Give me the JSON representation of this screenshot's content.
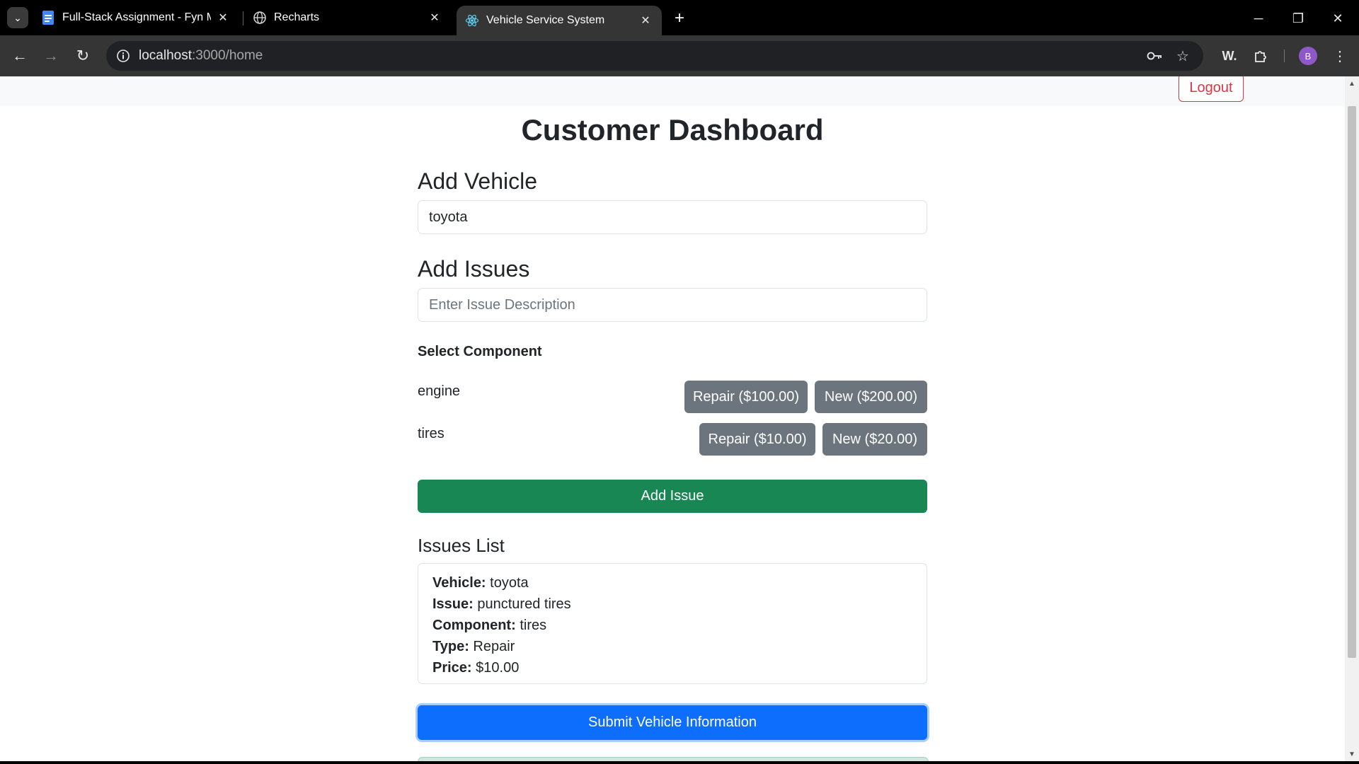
{
  "browser": {
    "tabs": [
      {
        "title": "Full-Stack Assignment - Fyn Mo",
        "favicon": "docs-icon"
      },
      {
        "title": "Recharts",
        "favicon": "globe-icon"
      },
      {
        "title": "Vehicle Service System",
        "favicon": "react-icon",
        "active": true
      }
    ],
    "url_host": "localhost",
    "url_path": ":3000/home",
    "profile_initial": "B",
    "extension_label": "W."
  },
  "nav": {
    "logout_label": "Logout"
  },
  "page": {
    "title": "Customer Dashboard",
    "add_vehicle": {
      "heading": "Add Vehicle",
      "value": "toyota"
    },
    "add_issues": {
      "heading": "Add Issues",
      "placeholder": "Enter Issue Description",
      "select_label": "Select Component",
      "components": [
        {
          "name": "engine",
          "repair_label": "Repair ($100.00)",
          "new_label": "New ($200.00)"
        },
        {
          "name": "tires",
          "repair_label": "Repair ($10.00)",
          "new_label": "New ($20.00)"
        }
      ],
      "add_issue_label": "Add Issue"
    },
    "issues_list": {
      "heading": "Issues List",
      "items": [
        {
          "vehicle_key": "Vehicle:",
          "vehicle": "toyota",
          "issue_key": "Issue:",
          "issue": "punctured tires",
          "component_key": "Component:",
          "component": "tires",
          "type_key": "Type:",
          "type": "Repair",
          "price_key": "Price:",
          "price": "$10.00"
        }
      ]
    },
    "submit_label": "Submit Vehicle Information"
  },
  "colors": {
    "primary": "#0d6efd",
    "success": "#198754",
    "secondary": "#6c757d",
    "danger": "#dc3545"
  }
}
